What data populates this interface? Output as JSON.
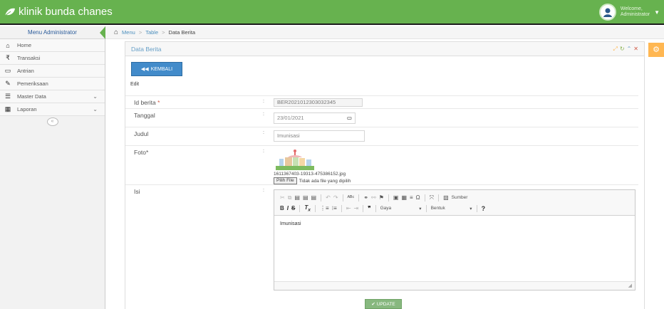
{
  "app": {
    "title": "klinik bunda chanes"
  },
  "user": {
    "welcome": "Welcome,",
    "name": "Administrator"
  },
  "sidebar": {
    "header": "Menu Administrator",
    "items": [
      {
        "label": "Home",
        "icon": "home-icon"
      },
      {
        "label": "Transaksi",
        "icon": "transaction-icon"
      },
      {
        "label": "Antrian",
        "icon": "monitor-icon"
      },
      {
        "label": "Pemeriksaan",
        "icon": "edit-icon"
      },
      {
        "label": "Master Data",
        "icon": "list-icon",
        "has_submenu": true
      },
      {
        "label": "Laporan",
        "icon": "calendar-icon",
        "has_submenu": true
      }
    ],
    "collapse_symbol": "«"
  },
  "breadcrumb": {
    "items": [
      "Menu",
      "Table",
      "Data Berita"
    ],
    "separator": ">"
  },
  "box": {
    "title": "Data Berita"
  },
  "actions": {
    "back_label": "KEMBALI",
    "update_label": "UPDATE"
  },
  "form": {
    "mode": "Edit",
    "id_berita": {
      "label": "Id berita",
      "value": "BER2021012303032345"
    },
    "tanggal": {
      "label": "Tanggal",
      "value": "23/01/2021"
    },
    "judul": {
      "label": "Judul",
      "value": "Imunisasi"
    },
    "foto": {
      "label": "Foto*",
      "filename": "1611367403-19313-475386152.jpg",
      "choose_label": "Pilih File",
      "no_file_text": "Tidak ada file yang dipilih"
    },
    "isi": {
      "label": "Isi",
      "content": "Imunisasi"
    }
  },
  "editor": {
    "source_label": "Sumber",
    "style_label": "Gaya",
    "format_label": "Bentuk"
  },
  "colors": {
    "navbar": "#67b24f",
    "primary": "#428bca",
    "success": "#87b87f",
    "warning": "#ffb752",
    "danger": "#d15b47"
  }
}
